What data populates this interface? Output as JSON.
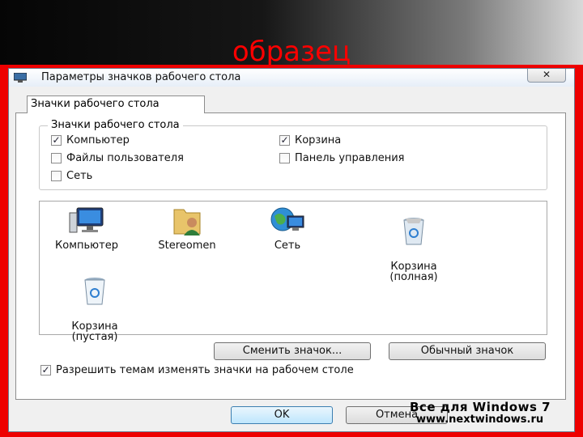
{
  "slide": {
    "title": "образец"
  },
  "dialog": {
    "title": "Параметры значков рабочего стола",
    "close_label": "✕",
    "tab_label": "Значки рабочего стола",
    "group_label": "Значки рабочего стола",
    "checkboxes": [
      {
        "label": "Компьютер",
        "checked": true
      },
      {
        "label": "Корзина",
        "checked": true
      },
      {
        "label": "Файлы пользователя",
        "checked": false
      },
      {
        "label": "Панель управления",
        "checked": false
      },
      {
        "label": "Сеть",
        "checked": false
      }
    ],
    "icons": [
      {
        "label": "Компьютер",
        "icon": "computer-icon"
      },
      {
        "label": "Stereomen",
        "icon": "user-folder-icon"
      },
      {
        "label": "Сеть",
        "icon": "network-icon"
      },
      {
        "label": "Корзина\n(полная)",
        "icon": "recycle-bin-full-icon"
      },
      {
        "label": "Корзина\n(пустая)",
        "icon": "recycle-bin-empty-icon"
      }
    ],
    "change_icon_button": "Сменить значок...",
    "default_icon_button": "Обычный значок",
    "allow_themes_label": "Разрешить темам изменять значки на рабочем столе",
    "allow_themes_checked": true,
    "ok_button": "OK",
    "cancel_button": "Отмена"
  },
  "watermark": {
    "line1": "Все для Windows 7",
    "line2": "www.nextwindows.ru"
  }
}
